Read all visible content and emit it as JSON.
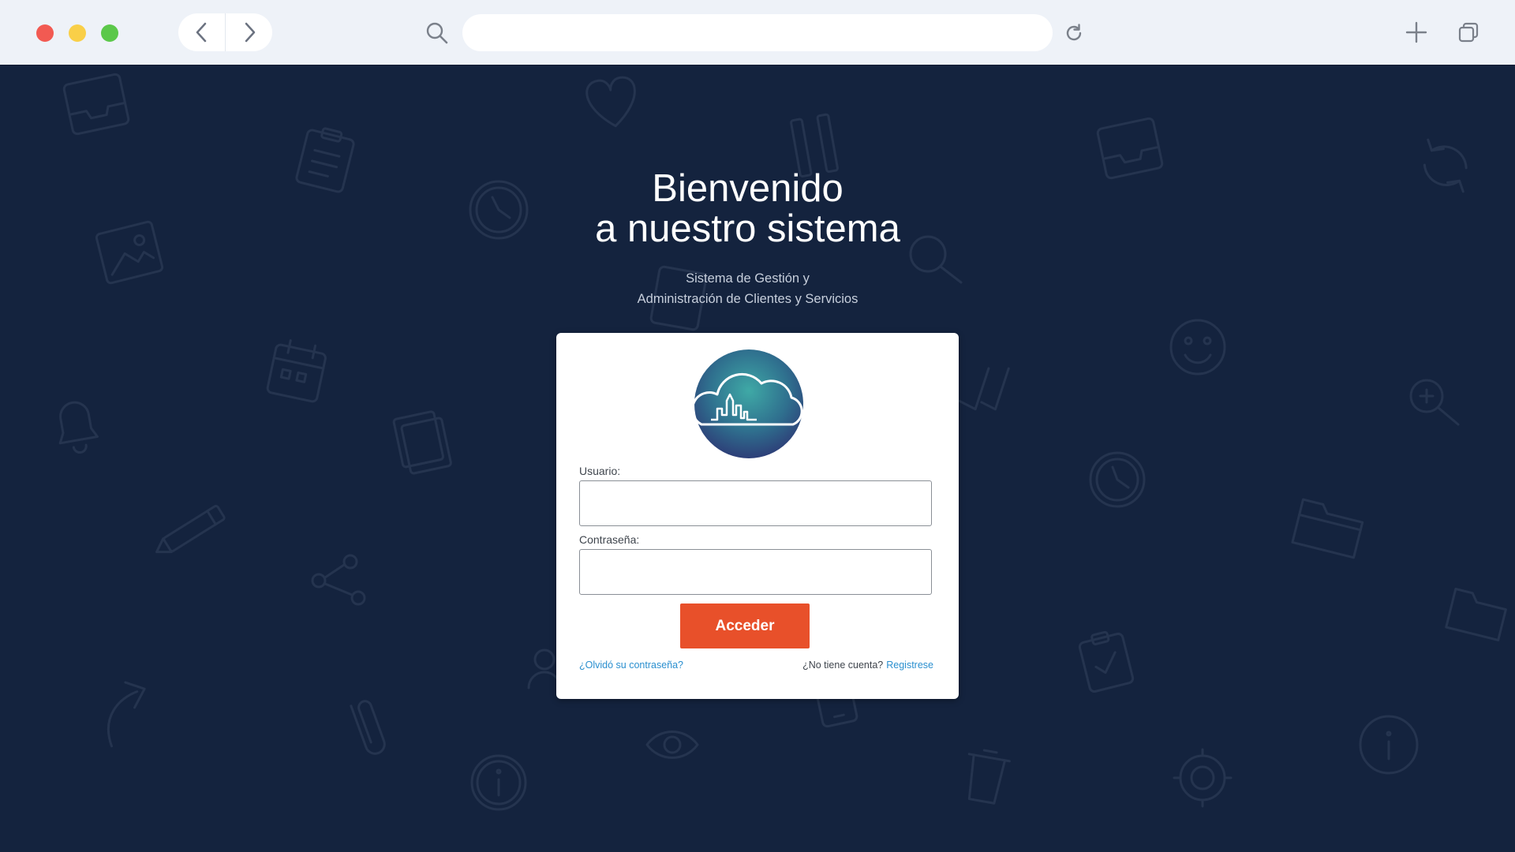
{
  "browser": {
    "url_value": "",
    "icons": {
      "back": "chevron-left-icon",
      "forward": "chevron-right-icon",
      "search": "search-icon",
      "reload": "reload-icon",
      "new_tab": "plus-icon",
      "tabs": "tabs-icon"
    },
    "colors": {
      "close": "#f25a52",
      "minimize": "#f9cf48",
      "maximize": "#5bc84a"
    }
  },
  "hero": {
    "title_line1": "Bienvenido",
    "title_line2": "a nuestro sistema",
    "subtitle_line1": "Sistema de Gestión y",
    "subtitle_line2": "Administración de Clientes y Servicios"
  },
  "login": {
    "username_label": "Usuario:",
    "username_value": "",
    "password_label": "Contraseña:",
    "password_value": "",
    "submit_label": "Acceder",
    "forgot_link": "¿Olvidó su contraseña?",
    "no_account_text": "¿No tiene cuenta?",
    "register_link": "Registrese",
    "accent_color": "#e8502a",
    "link_color": "#2a8fcf"
  },
  "theme": {
    "background": "#14233e",
    "doodle_color": "#25344f"
  }
}
